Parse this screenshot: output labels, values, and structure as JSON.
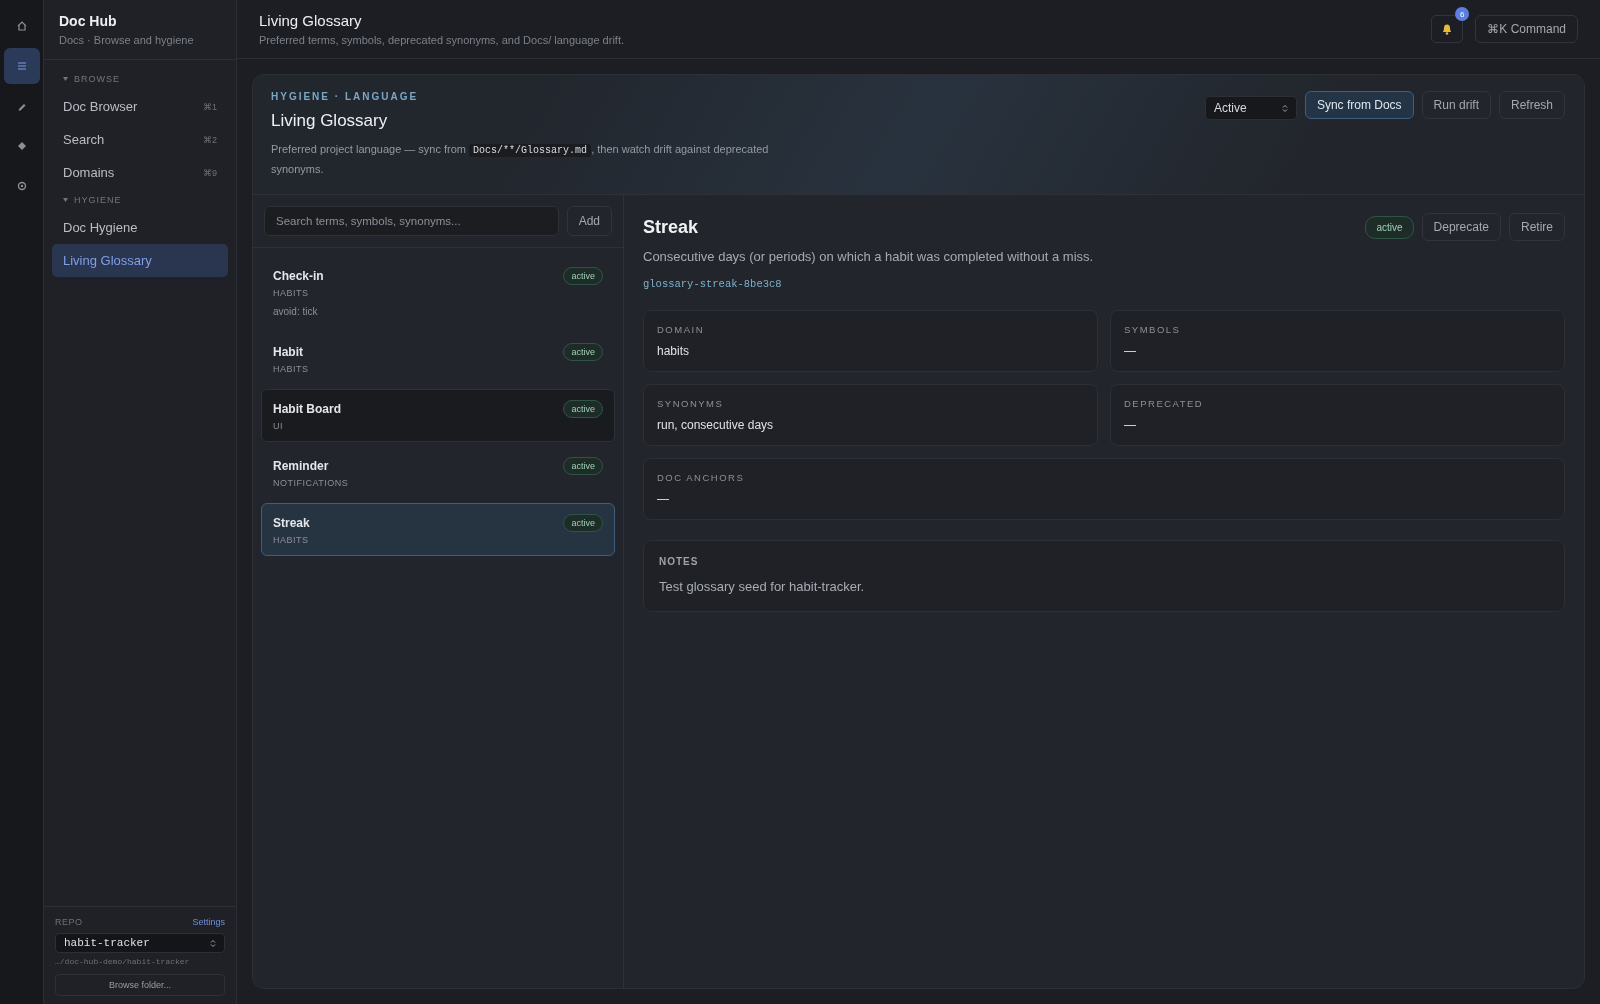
{
  "rail": [
    {
      "kind": "home",
      "selected": false
    },
    {
      "kind": "list",
      "selected": true
    },
    {
      "kind": "pencil",
      "selected": false
    },
    {
      "kind": "diamond",
      "selected": false
    },
    {
      "kind": "gear",
      "selected": false
    }
  ],
  "sidebar": {
    "title": "Doc Hub",
    "subtitle": "Docs · Browse and hygiene",
    "groups": [
      {
        "label": "BROWSE",
        "items": [
          {
            "label": "Doc Browser",
            "shortcut": "⌘1",
            "selected": false
          },
          {
            "label": "Search",
            "shortcut": "⌘2",
            "selected": false
          },
          {
            "label": "Domains",
            "shortcut": "⌘9",
            "selected": false
          }
        ]
      },
      {
        "label": "HYGIENE",
        "items": [
          {
            "label": "Doc Hygiene",
            "selected": false
          },
          {
            "label": "Living Glossary",
            "selected": true
          }
        ]
      }
    ],
    "repo": {
      "label": "REPO",
      "settings": "Settings",
      "value": "habit-tracker",
      "path": "…/doc-hub-demo/habit-tracker",
      "browse": "Browse folder..."
    }
  },
  "header": {
    "title": "Living Glossary",
    "subtitle": "Preferred terms, symbols, deprecated synonyms, and Docs/ language drift.",
    "notifications": "6",
    "command": "⌘K Command"
  },
  "panel": {
    "eyebrow": "HYGIENE · LANGUAGE",
    "title": "Living Glossary",
    "desc_before": "Preferred project language — sync from ",
    "desc_code": "Docs/**/Glossary.md",
    "desc_after": ", then watch drift against deprecated synonyms.",
    "filter": "Active",
    "buttons": [
      {
        "label": "Sync from Docs",
        "primary": true
      },
      {
        "label": "Run drift",
        "primary": false
      },
      {
        "label": "Refresh",
        "primary": false
      }
    ]
  },
  "search": {
    "placeholder": "Search terms, symbols, synonyms...",
    "add": "Add"
  },
  "terms": [
    {
      "name": "Check-in",
      "domain": "HABITS",
      "note": "avoid: tick",
      "status": "active",
      "selected": false,
      "hovered": false
    },
    {
      "name": "Habit",
      "domain": "HABITS",
      "status": "active",
      "selected": false,
      "hovered": false
    },
    {
      "name": "Habit Board",
      "domain": "UI",
      "status": "active",
      "selected": false,
      "hovered": true
    },
    {
      "name": "Reminder",
      "domain": "NOTIFICATIONS",
      "status": "active",
      "selected": false,
      "hovered": false
    },
    {
      "name": "Streak",
      "domain": "HABITS",
      "status": "active",
      "selected": true,
      "hovered": false
    }
  ],
  "detail": {
    "title": "Streak",
    "status": "active",
    "actions": [
      "Deprecate",
      "Retire"
    ],
    "definition": "Consecutive days (or periods) on which a habit was completed without a miss.",
    "id": "glossary-streak-8be3c8",
    "fields": [
      {
        "label": "DOMAIN",
        "value": "habits",
        "wide": false
      },
      {
        "label": "SYMBOLS",
        "value": "—",
        "wide": false
      },
      {
        "label": "SYNONYMS",
        "value": "run, consecutive days",
        "wide": false
      },
      {
        "label": "DEPRECATED",
        "value": "—",
        "wide": false
      },
      {
        "label": "DOC ANCHORS",
        "value": "—",
        "wide": true
      }
    ],
    "notes": {
      "label": "NOTES",
      "value": "Test glossary seed for habit-tracker."
    }
  }
}
